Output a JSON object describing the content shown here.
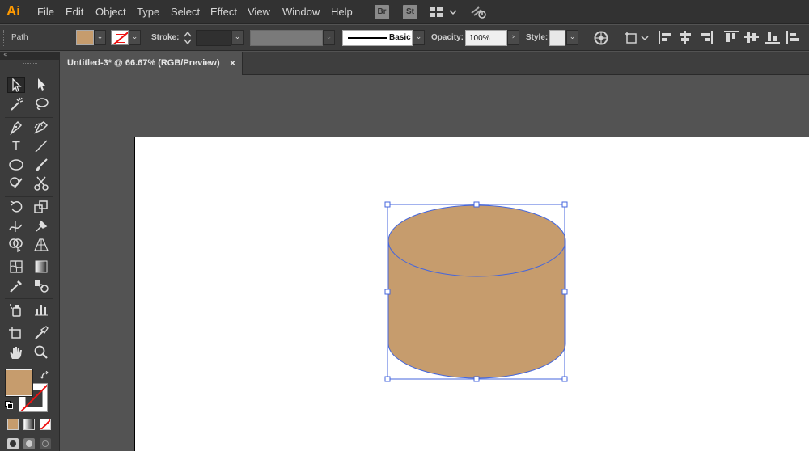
{
  "app": {
    "logo": "Ai",
    "bridge_icon": "Br",
    "stock_icon": "St"
  },
  "menu": [
    "File",
    "Edit",
    "Object",
    "Type",
    "Select",
    "Effect",
    "View",
    "Window",
    "Help"
  ],
  "control": {
    "selection_type": "Path",
    "fill_color": "#c69c6d",
    "stroke_label": "Stroke:",
    "brush_name": "Basic",
    "opacity_label": "Opacity:",
    "opacity_value": "100%",
    "style_label": "Style:"
  },
  "document": {
    "tab_title": "Untitled-3* @ 66.67% (RGB/Preview)",
    "close_glyph": "×"
  },
  "artwork": {
    "fill": "#c69c6d",
    "path_color": "#4466dd"
  },
  "tools": {
    "fill_color": "#c69c6d"
  }
}
